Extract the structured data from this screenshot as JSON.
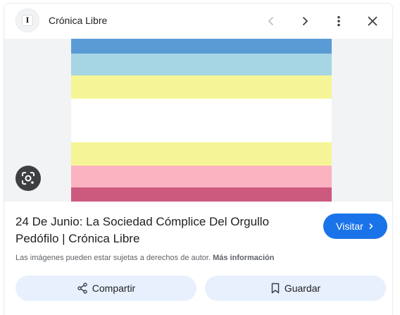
{
  "header": {
    "site_name": "Crónica Libre",
    "site_icon_letter": "I",
    "icons": [
      "back-icon",
      "forward-icon",
      "more-vert-icon",
      "close-icon"
    ]
  },
  "image": {
    "stripes": [
      "#5b9bd5",
      "#a6d5e3",
      "#f5f597",
      "#ffffff",
      "#f5f597",
      "#fcb3c1",
      "#cc5a7e"
    ],
    "lens_icon": "lens-icon"
  },
  "result": {
    "title": "24 De Junio: La Sociedad Cómplice Del Orgullo Pedófilo | Crónica Libre",
    "visit_label": "Visitar",
    "copyright_text": "Las imágenes pueden estar sujetas a derechos de autor.",
    "more_info_label": "Más información"
  },
  "actions": {
    "share_label": "Compartir",
    "save_label": "Guardar"
  },
  "colors": {
    "accent": "#1a73e8",
    "button_bg": "#e8f0fe"
  }
}
